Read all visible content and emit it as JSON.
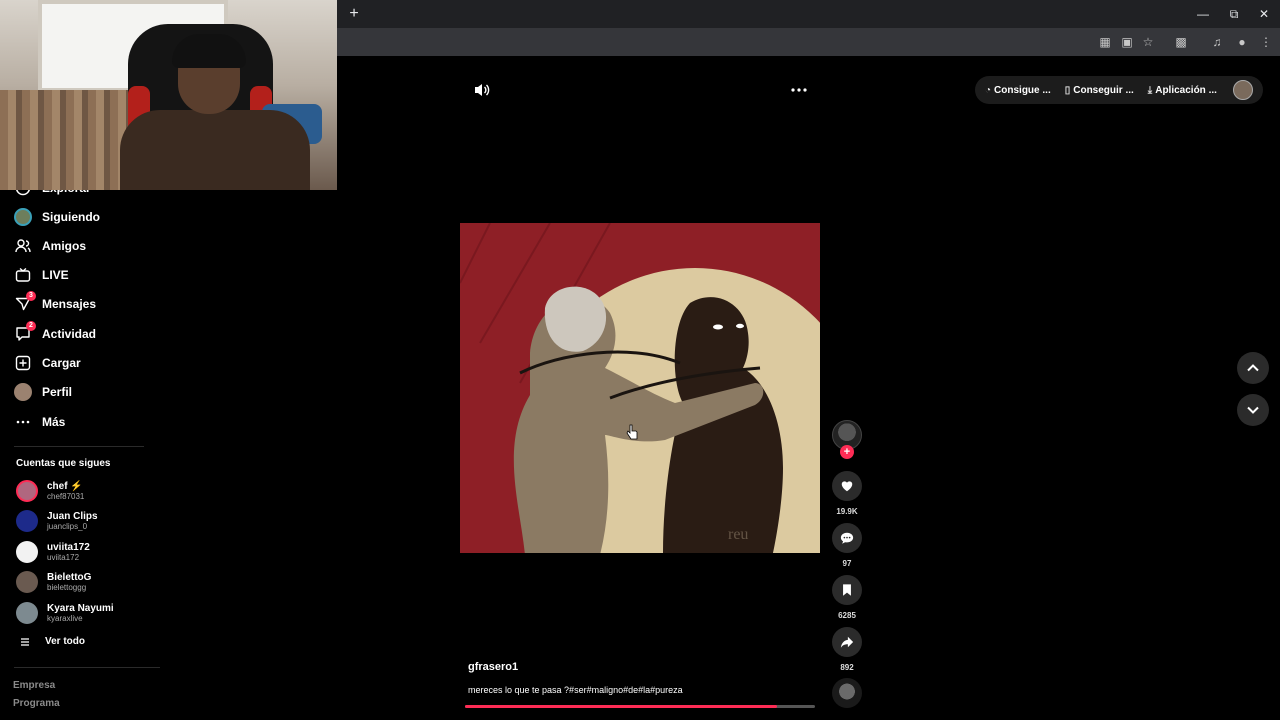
{
  "browser": {
    "new_tab_label": "+"
  },
  "sidebar": {
    "partial_item_label": "Explorar",
    "items": [
      {
        "label": "Siguiendo",
        "icon": "following-avatar-icon"
      },
      {
        "label": "Amigos",
        "icon": "friends-icon"
      },
      {
        "label": "LIVE",
        "icon": "live-tv-icon"
      },
      {
        "label": "Mensajes",
        "icon": "messages-icon",
        "badge": "3"
      },
      {
        "label": "Actividad",
        "icon": "activity-icon",
        "badge": "2"
      },
      {
        "label": "Cargar",
        "icon": "upload-icon"
      },
      {
        "label": "Perfil",
        "icon": "profile-avatar-icon"
      },
      {
        "label": "Más",
        "icon": "more-icon"
      }
    ],
    "following_title": "Cuentas que sigues",
    "following": [
      {
        "name": "chef",
        "handle": "chef87031"
      },
      {
        "name": "Juan Clips",
        "handle": "juanclips_0"
      },
      {
        "name": "uviita172",
        "handle": "uviita172"
      },
      {
        "name": "BielettoG",
        "handle": "bielettoggg"
      },
      {
        "name": "Kyara Nayumi",
        "handle": "kyaraxlive"
      }
    ],
    "see_all": "Ver todo",
    "footer": [
      "Empresa",
      "Programa"
    ]
  },
  "topbar": {
    "pills": [
      "Consigue ...",
      "Conseguir ...",
      "Aplicación ..."
    ]
  },
  "video": {
    "author": "gfrasero1",
    "caption": "mereces lo que te pasa ?#ser#maligno#de#la#pureza",
    "watermark": "reu",
    "progress": 0.89
  },
  "actions": {
    "likes": "19.9K",
    "comments": "97",
    "saves": "6285",
    "shares": "892",
    "follow_plus": "+"
  },
  "colors": {
    "accent": "#fe2c55",
    "background": "#000000",
    "button_bg": "#2b2b2b"
  }
}
